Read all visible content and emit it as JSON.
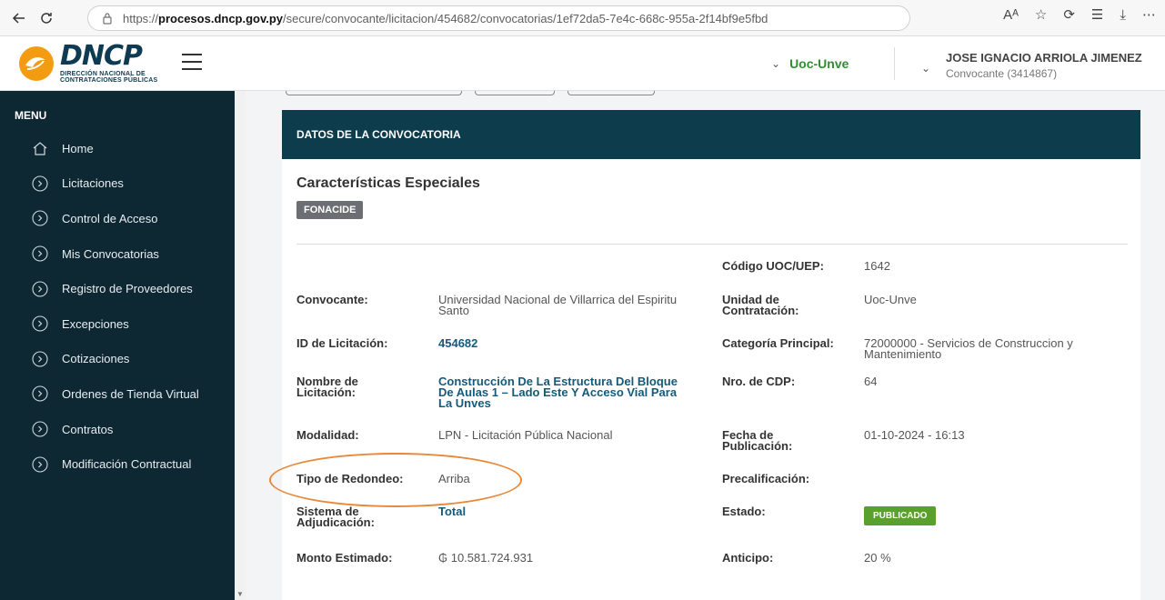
{
  "browser": {
    "url_prefix": "https://",
    "url_host": "procesos.dncp.gov.py",
    "url_path": "/secure/convocante/licitacion/454682/convocatorias/1ef72da5-7e4c-668c-955a-2f14bf9e5fbd"
  },
  "brand": {
    "name": "DNCP",
    "subtitle_line1": "DIRECCIÓN NACIONAL DE",
    "subtitle_line2": "CONTRATACIONES PÚBLICAS"
  },
  "header": {
    "uoc_label": "Uoc-Unve",
    "user_name": "JOSE IGNACIO ARRIOLA JIMENEZ",
    "user_role": "Convocante (3414867)"
  },
  "sidebar": {
    "title": "MENU",
    "items": [
      {
        "label": "Home",
        "icon": "home-icon"
      },
      {
        "label": "Licitaciones",
        "icon": "chevron-circle-icon"
      },
      {
        "label": "Control de Acceso",
        "icon": "chevron-circle-icon"
      },
      {
        "label": "Mis Convocatorias",
        "icon": "chevron-circle-icon"
      },
      {
        "label": "Registro de Proveedores",
        "icon": "chevron-circle-icon"
      },
      {
        "label": "Excepciones",
        "icon": "chevron-circle-icon"
      },
      {
        "label": "Cotizaciones",
        "icon": "chevron-circle-icon"
      },
      {
        "label": "Ordenes de Tienda Virtual",
        "icon": "chevron-circle-icon"
      },
      {
        "label": "Contratos",
        "icon": "chevron-circle-icon"
      },
      {
        "label": "Modificación Contractual",
        "icon": "chevron-circle-icon"
      }
    ]
  },
  "card": {
    "header": "DATOS DE LA CONVOCATORIA",
    "section_title": "Características Especiales",
    "tag": "FONACIDE"
  },
  "fields": {
    "codigo_uoc_label": "Código UOC/UEP:",
    "codigo_uoc_value": "1642",
    "convocante_label": "Convocante:",
    "convocante_value_l1": "Universidad Nacional de Villarrica del Espiritu",
    "convocante_value_l2": "Santo",
    "unidad_label_l1": "Unidad de",
    "unidad_label_l2": "Contratación:",
    "unidad_value": "Uoc-Unve",
    "id_label": "ID de Licitación:",
    "id_value": "454682",
    "categoria_label": "Categoría Principal:",
    "categoria_value_l1": "72000000 - Servicios de Construccion y",
    "categoria_value_l2": "Mantenimiento",
    "nombre_label_l1": "Nombre de",
    "nombre_label_l2": "Licitación:",
    "nombre_value_l1": "Construcción De La Estructura Del Bloque",
    "nombre_value_l2": "De Aulas 1 – Lado Este Y Acceso Vial Para",
    "nombre_value_l3": "La Unves",
    "cdp_label": "Nro. de CDP:",
    "cdp_value": "64",
    "modalidad_label": "Modalidad:",
    "modalidad_value": "LPN - Licitación Pública Nacional",
    "fecha_label_l1": "Fecha de",
    "fecha_label_l2": "Publicación:",
    "fecha_value": "01-10-2024 - 16:13",
    "redondeo_label": "Tipo de Redondeo:",
    "redondeo_value": "Arriba",
    "precalificacion_label": "Precalificación:",
    "sistema_label_l1": "Sistema de",
    "sistema_label_l2": "Adjudicación:",
    "sistema_value": "Total",
    "estado_label": "Estado:",
    "estado_value": "PUBLICADO",
    "monto_label": "Monto Estimado:",
    "monto_value": "₲ 10.581.724.931",
    "anticipo_label": "Anticipo:",
    "anticipo_value": "20 %"
  },
  "colors": {
    "sidebar_bg": "#0d2733",
    "card_header_bg": "#0d3c4d",
    "link": "#155a7a",
    "status_published": "#5aa02c",
    "annotation": "#e8883a",
    "uoc_green": "#2f8f2f"
  }
}
